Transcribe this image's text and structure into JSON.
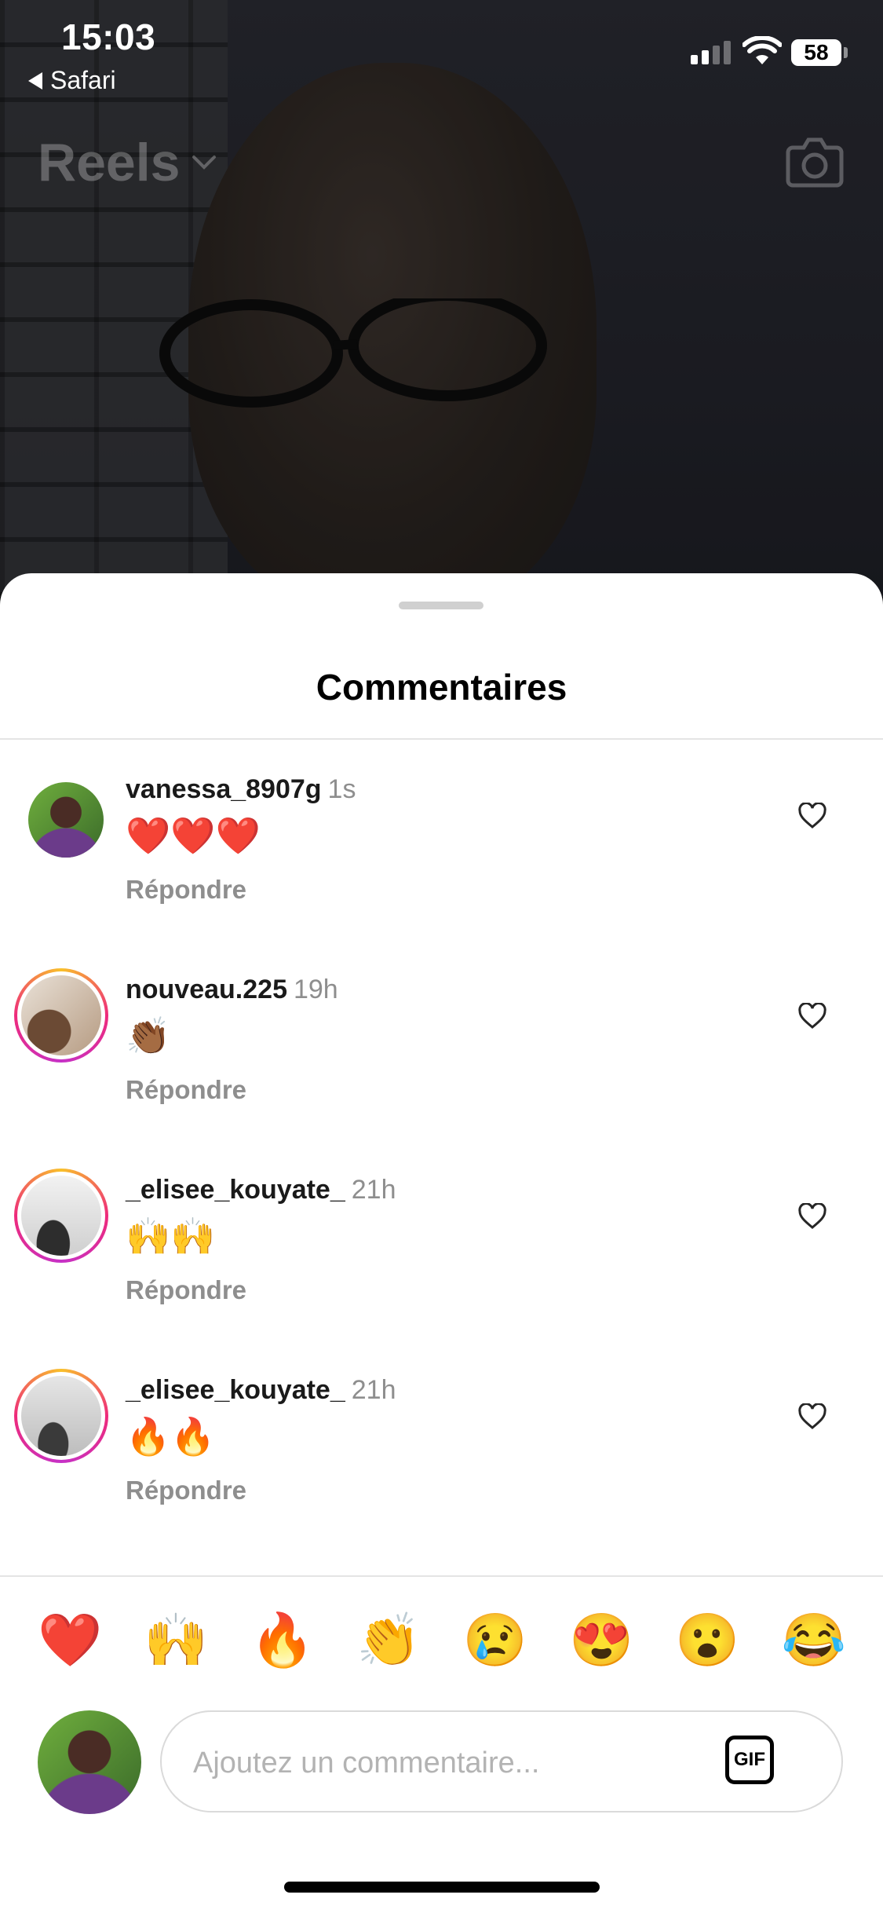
{
  "status_bar": {
    "time": "15:03",
    "back_app": "Safari",
    "battery": "58"
  },
  "header": {
    "title": "Reels",
    "camera_icon": "camera-icon"
  },
  "sheet": {
    "title": "Commentaires"
  },
  "comments": [
    {
      "username": "vanessa_8907g",
      "time": "1s",
      "text": "❤️❤️❤️",
      "reply_label": "Répondre"
    },
    {
      "username": "nouveau.225",
      "time": "19h",
      "text": "👏🏾",
      "reply_label": "Répondre"
    },
    {
      "username": "_elisee_kouyate_",
      "time": "21h",
      "text": "🙌🙌",
      "reply_label": "Répondre"
    },
    {
      "username": "_elisee_kouyate_",
      "time": "21h",
      "text": "🔥🔥",
      "reply_label": "Répondre"
    }
  ],
  "quick_reactions": [
    "❤️",
    "🙌",
    "🔥",
    "👏",
    "😢",
    "😍",
    "😮",
    "😂"
  ],
  "composer": {
    "placeholder": "Ajoutez un commentaire...",
    "gif_label": "GIF"
  }
}
